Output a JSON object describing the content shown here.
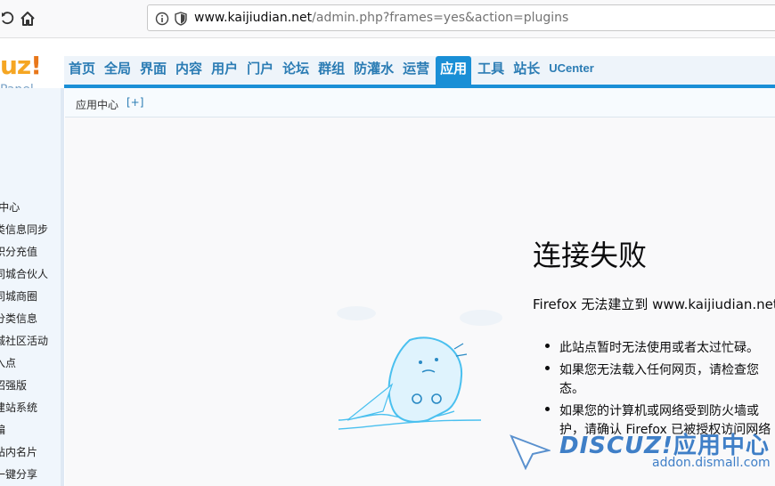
{
  "browser": {
    "url_host": "www.kaijiudian.net",
    "url_path": "/admin.php?frames=yes&action=plugins"
  },
  "logo": {
    "text": "uz",
    "bang": "!",
    "panel": "Panel"
  },
  "nav": {
    "tabs": [
      {
        "label": "首页"
      },
      {
        "label": "全局"
      },
      {
        "label": "界面"
      },
      {
        "label": "内容"
      },
      {
        "label": "用户"
      },
      {
        "label": "门户"
      },
      {
        "label": "论坛"
      },
      {
        "label": "群组"
      },
      {
        "label": "防灌水"
      },
      {
        "label": "运营"
      },
      {
        "label": "应用",
        "active": true
      },
      {
        "label": "工具"
      },
      {
        "label": "站长"
      },
      {
        "label": "UCenter"
      }
    ]
  },
  "breadcrumb": {
    "label": "应用中心",
    "add": "[+]"
  },
  "sidebar": {
    "items": [
      {
        "label": "f中心"
      },
      {
        "label": "类信息同步"
      },
      {
        "label": "积分充值"
      },
      {
        "label": "同城合伙人"
      },
      {
        "label": "同城商圈"
      },
      {
        "label": "分类信息"
      },
      {
        "label": "城社区活动"
      },
      {
        "label": "入点"
      },
      {
        "label": "招强版"
      },
      {
        "label": "建站系统"
      },
      {
        "label": "编"
      },
      {
        "label": "站内名片"
      },
      {
        "label": "一键分享"
      }
    ]
  },
  "error": {
    "title": "连接失败",
    "message": "Firefox 无法建立到 www.kaijiudian.net",
    "bullets": [
      {
        "line1": "此站点暂时无法使用或者太过忙碌。"
      },
      {
        "line1": "如果您无法载入任何网页，请检查您",
        "line2": "态。"
      },
      {
        "line1": "如果您的计算机或网络受到防火墙或",
        "line2": "护，请确认 Firefox 已被授权访问网络"
      }
    ]
  },
  "watermark": {
    "brand": "DISCUZ!",
    "suffix": "应用中心",
    "site": "addon.dismall.com"
  },
  "colors": {
    "accent": "#1a8fd6",
    "nav_text": "#2b7cb4",
    "logo": "#f5a623"
  }
}
